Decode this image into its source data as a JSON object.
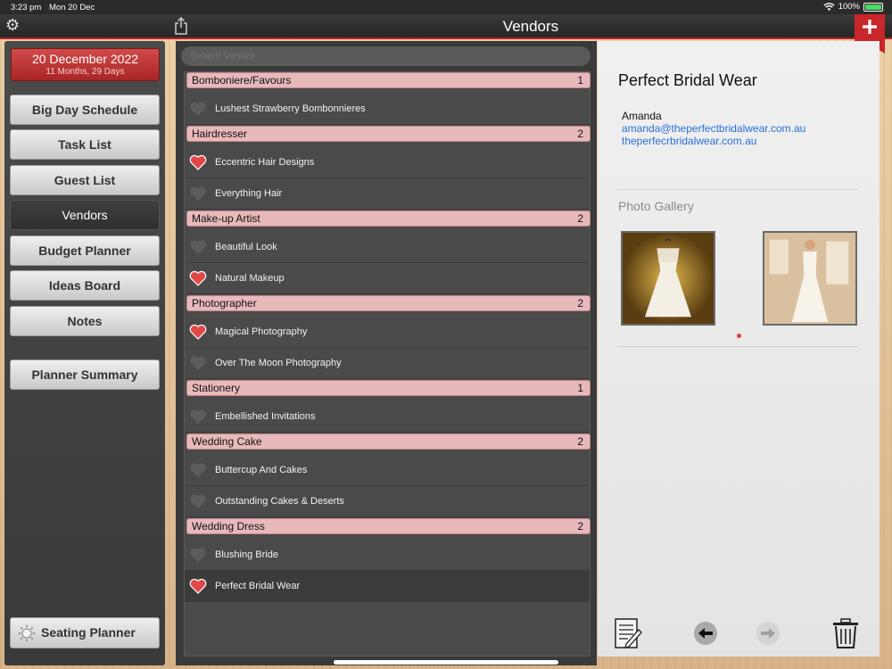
{
  "status": {
    "time": "3:23 pm",
    "date": "Mon 20 Dec",
    "battery_text": "100%",
    "battery_level": 1.0
  },
  "header": {
    "title": "Vendors"
  },
  "sidebar": {
    "date_title": "20 December 2022",
    "date_sub": "11 Months, 29 Days",
    "items": [
      {
        "label": "Big Day Schedule"
      },
      {
        "label": "Task List"
      },
      {
        "label": "Guest List"
      },
      {
        "label": "Vendors"
      },
      {
        "label": "Budget Planner"
      },
      {
        "label": "Ideas Board"
      },
      {
        "label": "Notes"
      },
      {
        "label": "Planner Summary"
      }
    ],
    "seating_label": "Seating Planner"
  },
  "search": {
    "placeholder": "Search Vendor"
  },
  "vendor_list": [
    {
      "category": "Bomboniere/Favours",
      "count": "1",
      "vendors": [
        {
          "name": "Lushest Strawberry Bombonnieres",
          "favourite": false
        }
      ]
    },
    {
      "category": "Hairdresser",
      "count": "2",
      "vendors": [
        {
          "name": "Eccentric Hair Designs",
          "favourite": true
        },
        {
          "name": "Everything Hair",
          "favourite": false
        }
      ]
    },
    {
      "category": "Make-up Artist",
      "count": "2",
      "vendors": [
        {
          "name": "Beautiful Look",
          "favourite": false
        },
        {
          "name": "Natural Makeup",
          "favourite": true
        }
      ]
    },
    {
      "category": "Photographer",
      "count": "2",
      "vendors": [
        {
          "name": "Magical Photography",
          "favourite": true
        },
        {
          "name": "Over The Moon Photography",
          "favourite": false
        }
      ]
    },
    {
      "category": "Stationery",
      "count": "1",
      "vendors": [
        {
          "name": "Embellished Invitations",
          "favourite": false
        }
      ]
    },
    {
      "category": "Wedding Cake",
      "count": "2",
      "vendors": [
        {
          "name": "Buttercup And Cakes",
          "favourite": false
        },
        {
          "name": "Outstanding Cakes & Deserts",
          "favourite": false
        }
      ]
    },
    {
      "category": "Wedding Dress",
      "count": "2",
      "vendors": [
        {
          "name": "Blushing Bride",
          "favourite": false
        },
        {
          "name": "Perfect Bridal Wear",
          "favourite": true,
          "selected": true
        }
      ]
    }
  ],
  "detail": {
    "name": "Perfect Bridal Wear",
    "contact": "Amanda",
    "email": "amanda@theperfectbridalwear.com.au",
    "website": "theperfecrbridalwear.com.au",
    "gallery_title": "Photo Gallery"
  },
  "colors": {
    "accent": "#b72024",
    "section_bg": "#e8b9bb",
    "link": "#2a6fd8",
    "heart_on": "#e04848",
    "heart_off": "#5c5c5c"
  }
}
